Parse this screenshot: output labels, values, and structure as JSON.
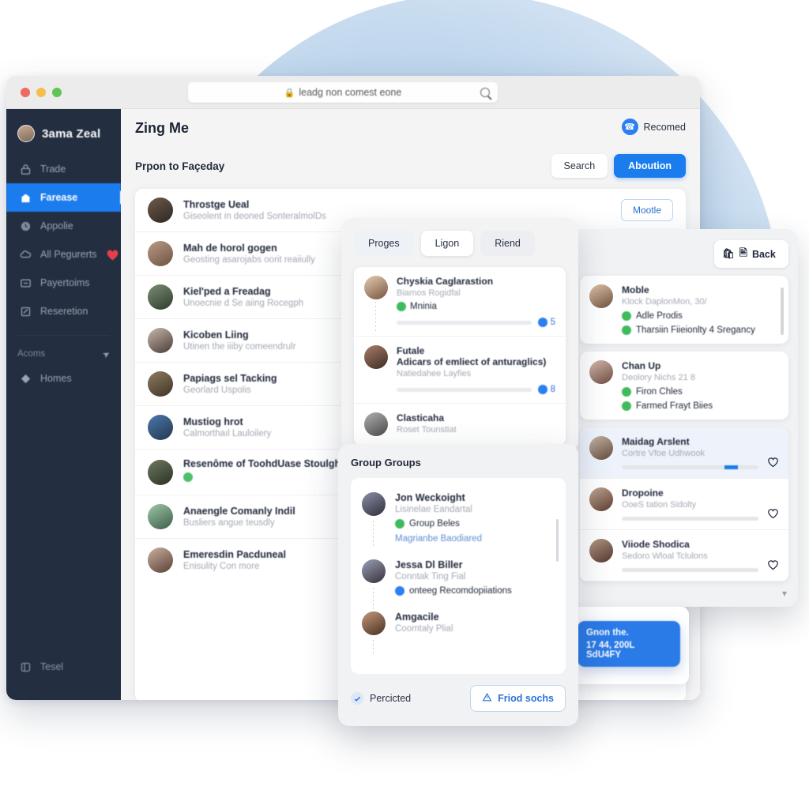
{
  "browser": {
    "url_text": "leadg non comest eone",
    "lock_icon": "lock-icon",
    "search_icon": "search-icon",
    "traffic_lights": [
      "close",
      "minimize",
      "maximize"
    ]
  },
  "sidebar": {
    "brand": "3ama Zeal",
    "items": [
      {
        "label": "Trade",
        "icon": "lock-icon",
        "active": false,
        "badge": ""
      },
      {
        "label": "Farease",
        "icon": "home-icon",
        "active": true,
        "badge": ""
      },
      {
        "label": "Appolie",
        "icon": "clock-icon",
        "active": false,
        "badge": ""
      },
      {
        "label": "All Pegurerts",
        "icon": "cloud-icon",
        "active": false,
        "badge": "heart-badge"
      },
      {
        "label": "Payertoims",
        "icon": "card-icon",
        "active": false,
        "badge": ""
      },
      {
        "label": "Reseretion",
        "icon": "note-icon",
        "active": false,
        "badge": ""
      }
    ],
    "section_label": "Acoms",
    "section_icon": "arrow-icon",
    "section_items": [
      {
        "label": "Homes",
        "icon": "diamond-icon"
      }
    ],
    "footer": {
      "label": "Tesel",
      "icon": "panel-icon"
    }
  },
  "main": {
    "title": "Zing Me",
    "subtitle": "Prpon to Façeday",
    "recomed": {
      "label": "Recomed",
      "icon": "phone-icon"
    },
    "buttons": {
      "search": "Search",
      "primary": "Aboution"
    },
    "rows": [
      {
        "name": "Throstge Ueal",
        "sub": "Giseolent in deoned SonteralmolDs",
        "action": "Mootle",
        "verified": false
      },
      {
        "name": "Mah de horol gogen",
        "sub": "Geosting asarojabs oorit reaiiully",
        "action": "",
        "verified": false
      },
      {
        "name": "Kiel'ped a Freadag",
        "sub": "Unoecnie d Se aiing Rocegph",
        "action": "",
        "verified": false
      },
      {
        "name": "Kicoben Liing",
        "sub": "Utinen the iiiby comeendrulr",
        "action": "",
        "verified": false
      },
      {
        "name": "Papiags sel Tacking",
        "sub": "Georlard Uspolis",
        "action": "",
        "verified": false
      },
      {
        "name": "Mustiog hrot",
        "sub": "Calmorthaıl Lauloilery",
        "action": "",
        "verified": false
      },
      {
        "name": "Resenôme of ToohdUase Stoulght",
        "sub": "",
        "action": "",
        "verified": true
      },
      {
        "name": "Anaengle Comanly Indil",
        "sub": "Busliers angue teusdly",
        "action": "",
        "verified": false
      },
      {
        "name": "Emeresdin Pacduneal",
        "sub": "Enisulity Con more",
        "action": "",
        "verified": false
      }
    ]
  },
  "panel_mid": {
    "tabs": [
      {
        "label": "Proges",
        "selected": false
      },
      {
        "label": "Ligon",
        "selected": true
      },
      {
        "label": "Riend",
        "selected": false
      }
    ],
    "items": [
      {
        "name": "Chyskia Caglarastion",
        "sub": "Biarnos Rogidfal",
        "check": "Mninia",
        "check_color": "#3fbb5e",
        "count": "5",
        "count_icon": "check-badge-icon"
      },
      {
        "name": "Futale",
        "sub": "Adicars of emliect of anturaglics)",
        "sub2": "Natiedahee Layfies",
        "check": "",
        "count": "8",
        "count_icon": "check-badge-icon"
      },
      {
        "name": "Clasticaha",
        "sub": "Roset Tounstiat",
        "check": "",
        "count": "",
        "count_icon": ""
      }
    ]
  },
  "panel_right": {
    "back_button": {
      "label": "Back",
      "icons": [
        "bag-icon",
        "doc-icon"
      ]
    },
    "cards": [
      {
        "name": "Moble",
        "sub": "Klock DaplonMon, 30/",
        "lines": [
          {
            "text": "Adle Prodis",
            "color": "#3fbb5e"
          },
          {
            "text": "Tharsiin Fiieionlty 4 Sregancy",
            "color": "#3fbb5e"
          }
        ]
      },
      {
        "name": "Chan Up",
        "sub": "Deolory Nichs 21 8",
        "lines": [
          {
            "text": "Firon Chles",
            "color": "#3fbb5e"
          },
          {
            "text": "Farmed Frayt Biies",
            "color": "#3fbb5e"
          }
        ]
      }
    ],
    "rows": [
      {
        "name": "Maidag Arslent",
        "sub": "Cortre Vfoe Udhwook",
        "progress": 90,
        "highlight": true,
        "heart": "heart-outline-icon"
      },
      {
        "name": "Dropoine",
        "sub": "OoeS tation Sidolty",
        "progress": 0,
        "highlight": false,
        "heart": "heart-outline-icon"
      },
      {
        "name": "Viiode Shodica",
        "sub": "Sedoro Wloal Tclulons",
        "progress": 0,
        "highlight": false,
        "heart": "heart-outline-icon"
      }
    ],
    "chevron": "chevron-down-icon"
  },
  "panel_bottom": {
    "title": "Group Groups",
    "items": [
      {
        "name": "Jon Weckoight",
        "sub": "Lisinelae Eandartal",
        "check": "Group Beles",
        "check_color": "#3fbb5e",
        "link": "Magrianbe Baodiared"
      },
      {
        "name": "Jessa Dl Biller",
        "sub": "Conntak Ting Fial",
        "check": "onteeg Recomdopiiations",
        "check_color": "#2b7ff0",
        "link": ""
      },
      {
        "name": "Amgacile",
        "sub": "Coomtaly Plial",
        "check": "",
        "check_color": "",
        "link": ""
      }
    ],
    "footer": {
      "checkbox_label": "Percicted",
      "checkbox_icon": "check-circle-icon",
      "cta_label": "Friod sochs",
      "cta_icon": "alert-triangle-icon"
    }
  },
  "note_card": {
    "line1": "Gnon the.",
    "line2": "17 44, 200L SdU4FY"
  },
  "colors": {
    "accent": "#1b7ced",
    "sidebar": "#232e40",
    "background_circle": "#bdd5ec",
    "success": "#3fbb5e",
    "danger": "#e5404a"
  }
}
